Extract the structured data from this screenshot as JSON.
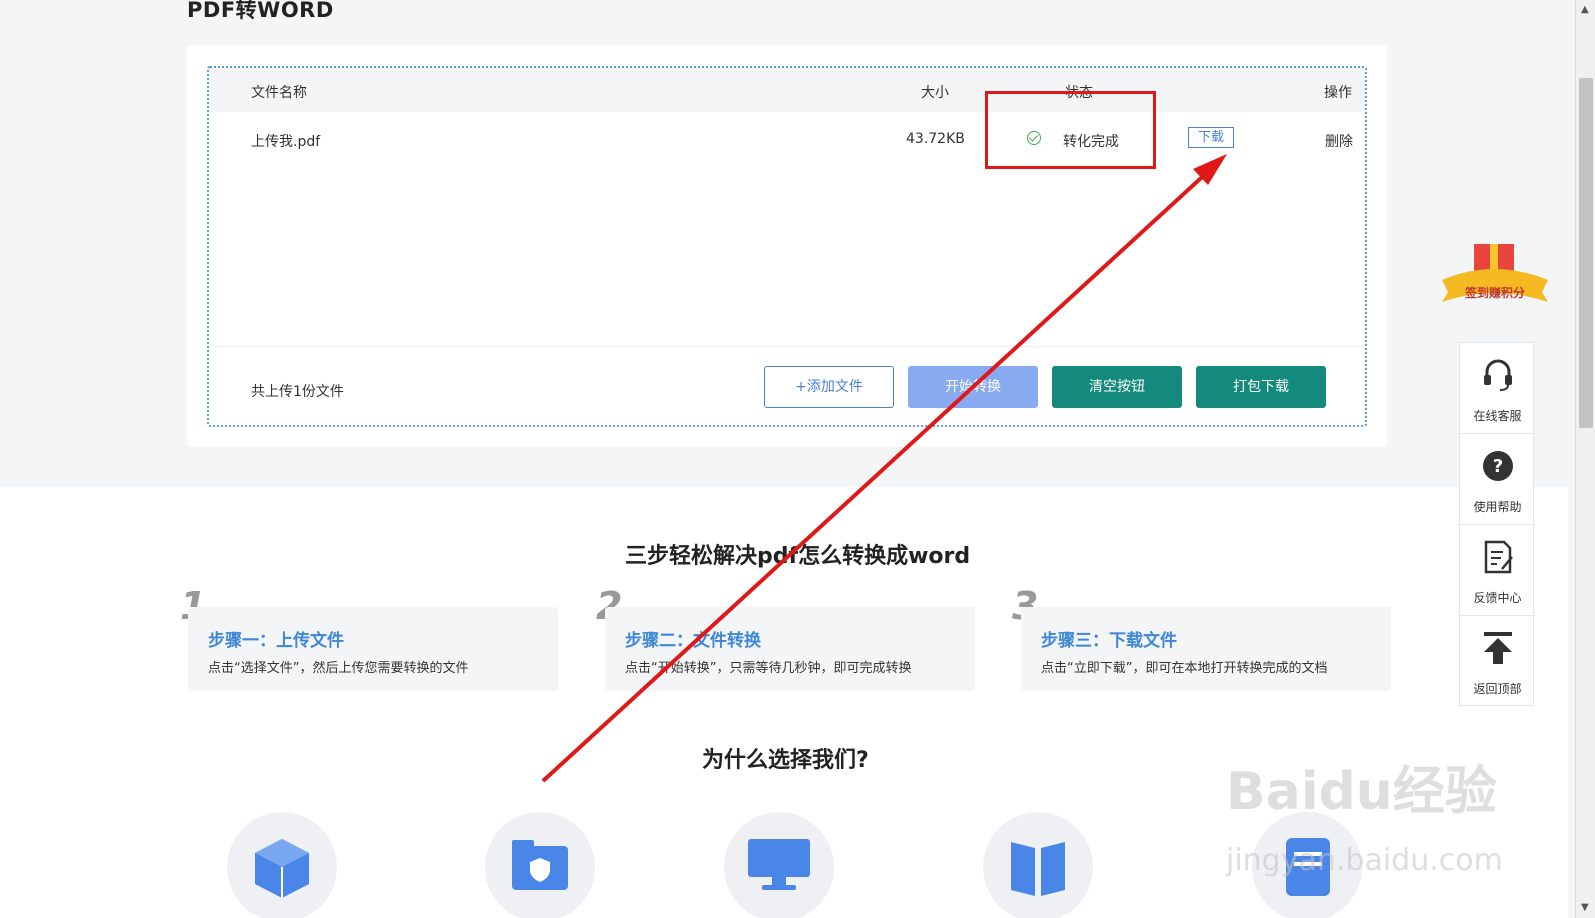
{
  "page": {
    "title": "PDF转WORD"
  },
  "table": {
    "headers": {
      "name": "文件名称",
      "size": "大小",
      "status": "状态",
      "action": "操作"
    },
    "rows": [
      {
        "name": "上传我.pdf",
        "size": "43.72KB",
        "status": "转化完成",
        "download": "下载",
        "delete": "删除"
      }
    ]
  },
  "footer": {
    "count_text": "共上传1份文件",
    "buttons": {
      "add": "+添加文件",
      "start": "开始转换",
      "clear": "清空按钮",
      "pack": "打包下载"
    }
  },
  "steps_section": {
    "title": "三步轻松解决pdf怎么转换成word",
    "steps": [
      {
        "num": "1",
        "title": "步骤一：上传文件",
        "desc": "点击“选择文件”，然后上传您需要转换的文件"
      },
      {
        "num": "2",
        "title": "步骤二：文件转换",
        "desc": "点击“开始转换”，只需等待几秒钟，即可完成转换"
      },
      {
        "num": "3",
        "title": "步骤三：下载文件",
        "desc": "点击“立即下载”，即可在本地打开转换完成的文档"
      }
    ]
  },
  "why_section": {
    "title": "为什么选择我们?"
  },
  "sidebar": {
    "items": [
      {
        "label": "在线客服",
        "icon": "headset-icon"
      },
      {
        "label": "使用帮助",
        "icon": "question-icon"
      },
      {
        "label": "反馈中心",
        "icon": "feedback-icon"
      },
      {
        "label": "返回顶部",
        "icon": "back-to-top-icon"
      }
    ],
    "gift_label": "签到赚积分"
  },
  "watermark": {
    "line1": "Baidu经验",
    "line2": "jingyan.baidu.com"
  },
  "colors": {
    "accent": "#3d86d8",
    "teal": "#138a7c",
    "annotation": "#e01818",
    "success": "#3bb24f"
  }
}
